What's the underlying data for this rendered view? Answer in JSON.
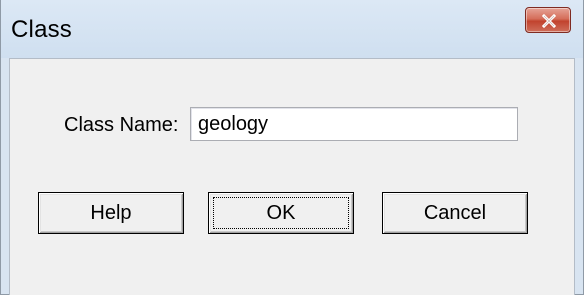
{
  "window": {
    "title": "Class",
    "close_icon": "close-icon"
  },
  "form": {
    "class_name_label": "Class Name:",
    "class_name_value": "geology"
  },
  "buttons": {
    "help_label": "Help",
    "ok_label": "OK",
    "cancel_label": "Cancel"
  },
  "colors": {
    "titlebar": "#d6e4f3",
    "close_button": "#c9503b",
    "dialog_background": "#f0f0f0"
  }
}
